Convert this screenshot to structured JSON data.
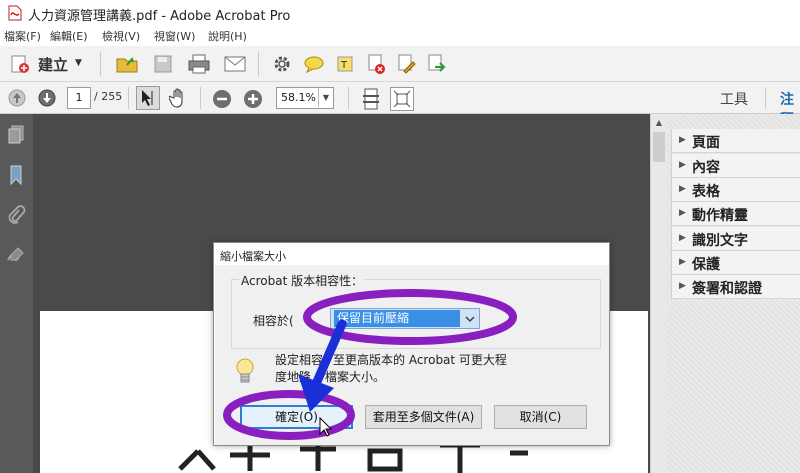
{
  "window": {
    "title": "人力資源管理講義.pdf - Adobe Acrobat Pro"
  },
  "menu": [
    "檔案(F)",
    "編輯(E)",
    "檢視(V)",
    "視窗(W)",
    "說明(H)"
  ],
  "toolbar": {
    "create_label": "建立",
    "page_current": "1",
    "page_total": "/ 255",
    "zoom": "58.1%",
    "tools_label": "工具",
    "comment_label": "注釋"
  },
  "right_panel": {
    "items": [
      "頁面",
      "內容",
      "表格",
      "動作精靈",
      "識別文字",
      "保護",
      "簽署和認證"
    ]
  },
  "dialog": {
    "title": "縮小檔案大小",
    "group_title": "Acrobat 版本相容性：",
    "compat_label": "相容於(",
    "compat_label_tail": "：",
    "compat_value": "保留目前壓縮",
    "tip_line1": "設定相容",
    "tip_line1_tail": "至更高版本的 Acrobat 可更大程",
    "tip_line2": "度地降",
    "tip_line2_tail": "檔案大小。",
    "ok_button": "確定(O)",
    "apply_multi_button": "套用至多個文件(A)",
    "cancel_button": "取消(C)"
  },
  "colors": {
    "highlight_ring": "#8a1fbf",
    "arrow": "#1a2fd6",
    "selection": "#3a8ee6",
    "comment_link": "#1c6bb0"
  }
}
